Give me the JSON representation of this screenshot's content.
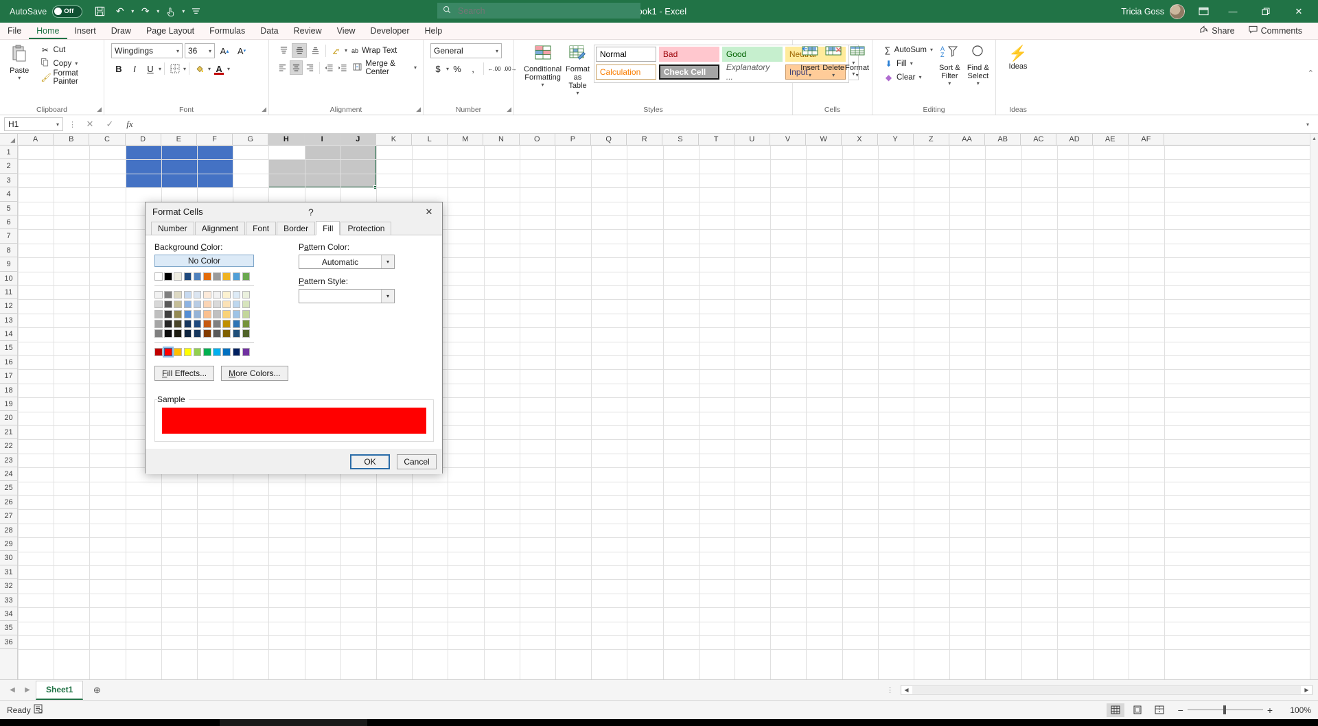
{
  "titlebar": {
    "autosave_label": "AutoSave",
    "autosave_state": "Off",
    "save_icon": "save-icon",
    "undo_icon": "undo-icon",
    "redo_icon": "redo-icon",
    "touch_icon": "touch-mode-icon",
    "customize_icon": "customize-quick-access-icon",
    "app_title": "Book1  -  Excel",
    "search_placeholder": "Search",
    "search_icon": "search-icon",
    "user_name": "Tricia Goss",
    "ribbon_display_icon": "ribbon-display-options-icon",
    "minimize_icon": "minimize-icon",
    "restore_icon": "restore-icon",
    "close_icon": "close-icon"
  },
  "tabs": [
    {
      "label": "File",
      "active": false
    },
    {
      "label": "Home",
      "active": true
    },
    {
      "label": "Insert",
      "active": false
    },
    {
      "label": "Draw",
      "active": false
    },
    {
      "label": "Page Layout",
      "active": false
    },
    {
      "label": "Formulas",
      "active": false
    },
    {
      "label": "Data",
      "active": false
    },
    {
      "label": "Review",
      "active": false
    },
    {
      "label": "View",
      "active": false
    },
    {
      "label": "Developer",
      "active": false
    },
    {
      "label": "Help",
      "active": false
    }
  ],
  "tabbar_right": {
    "share_label": "Share",
    "share_icon": "share-icon",
    "comments_label": "Comments",
    "comments_icon": "comments-icon"
  },
  "ribbon": {
    "clipboard": {
      "title": "Clipboard",
      "paste_label": "Paste",
      "paste_icon": "paste-icon",
      "cut_label": "Cut",
      "cut_icon": "scissors-icon",
      "copy_label": "Copy",
      "copy_icon": "copy-icon",
      "format_painter_label": "Format Painter",
      "format_painter_icon": "format-painter-icon",
      "launcher_icon": "dialog-launcher-icon"
    },
    "font": {
      "title": "Font",
      "font_name": "Wingdings",
      "font_size": "36",
      "grow_font_icon": "grow-font-icon",
      "shrink_font_icon": "shrink-font-icon",
      "bold_label": "B",
      "italic_label": "I",
      "underline_label": "U",
      "borders_icon": "borders-icon",
      "fill_color_icon": "fill-color-icon",
      "font_color_icon": "font-color-icon",
      "launcher_icon": "dialog-launcher-icon"
    },
    "alignment": {
      "title": "Alignment",
      "top_align_icon": "align-top-icon",
      "middle_align_icon": "align-middle-icon",
      "bottom_align_icon": "align-bottom-icon",
      "orientation_icon": "orientation-icon",
      "align_left_icon": "align-left-icon",
      "align_center_icon": "align-center-icon",
      "align_right_icon": "align-right-icon",
      "decrease_indent_icon": "decrease-indent-icon",
      "increase_indent_icon": "increase-indent-icon",
      "wrap_text_label": "Wrap Text",
      "wrap_text_icon": "wrap-text-icon",
      "merge_center_label": "Merge & Center",
      "merge_center_icon": "merge-center-icon",
      "launcher_icon": "dialog-launcher-icon"
    },
    "number": {
      "title": "Number",
      "format": "General",
      "currency_icon": "currency-icon",
      "percent_icon": "percent-icon",
      "comma_icon": "comma-style-icon",
      "increase_decimal_icon": "increase-decimal-icon",
      "decrease_decimal_icon": "decrease-decimal-icon",
      "launcher_icon": "dialog-launcher-icon"
    },
    "styles": {
      "title": "Styles",
      "conditional_formatting_label": "Conditional Formatting",
      "conditional_formatting_icon": "conditional-formatting-icon",
      "format_as_table_label": "Format as Table",
      "format_as_table_icon": "format-as-table-icon",
      "cells": [
        {
          "label": "Normal",
          "bg": "#ffffff",
          "fg": "#000000",
          "border": "#b0b0b0"
        },
        {
          "label": "Bad",
          "bg": "#ffc7ce",
          "fg": "#9c0006",
          "border": "#ffc7ce"
        },
        {
          "label": "Good",
          "bg": "#c6efce",
          "fg": "#006100",
          "border": "#c6efce"
        },
        {
          "label": "Neutral",
          "bg": "#ffeb9c",
          "fg": "#9c6500",
          "border": "#ffeb9c"
        },
        {
          "label": "Calculation",
          "bg": "#ffffff",
          "fg": "#fa7d00",
          "border": "#d0a060"
        },
        {
          "label": "Check Cell",
          "bg": "#a5a5a5",
          "fg": "#ffffff",
          "border": "#1a1a1a"
        },
        {
          "label": "Explanatory ...",
          "bg": "#ffffff",
          "fg": "#5a5a5a",
          "border": "#ffffff"
        },
        {
          "label": "Input",
          "bg": "#ffcc99",
          "fg": "#3f3f76",
          "border": "#cc9966"
        }
      ],
      "scroll_up_icon": "scroll-up-icon",
      "scroll_down_icon": "scroll-down-icon",
      "more_icon": "more-styles-icon"
    },
    "cells": {
      "title": "Cells",
      "insert_label": "Insert",
      "insert_icon": "insert-cells-icon",
      "delete_label": "Delete",
      "delete_icon": "delete-cells-icon",
      "format_label": "Format",
      "format_icon": "format-cells-icon"
    },
    "editing": {
      "title": "Editing",
      "autosum_label": "AutoSum",
      "autosum_icon": "sigma-icon",
      "fill_label": "Fill",
      "fill_icon": "fill-down-icon",
      "clear_label": "Clear",
      "clear_icon": "eraser-icon",
      "sort_filter_label": "Sort & Filter",
      "sort_filter_icon": "sort-filter-icon",
      "find_select_label": "Find & Select",
      "find_select_icon": "magnifier-icon"
    },
    "ideas": {
      "title": "Ideas",
      "ideas_label": "Ideas",
      "ideas_icon": "ideas-lightning-icon"
    },
    "collapse_icon": "collapse-ribbon-icon"
  },
  "formulabar": {
    "namebox_value": "H1",
    "namebox_caret_icon": "chevron-down-icon",
    "cancel_icon": "cancel-icon",
    "enter_icon": "enter-icon",
    "function_icon": "insert-function-icon",
    "formula_value": "",
    "expand_icon": "expand-formula-bar-icon"
  },
  "grid": {
    "columns": [
      "A",
      "B",
      "C",
      "D",
      "E",
      "F",
      "G",
      "H",
      "I",
      "J",
      "K",
      "L",
      "M",
      "N",
      "O",
      "P",
      "Q",
      "R",
      "S",
      "T",
      "U",
      "V",
      "W",
      "X",
      "Y",
      "Z",
      "AA",
      "AB",
      "AC",
      "AD",
      "AE",
      "AF"
    ],
    "selected_columns": [
      "H",
      "I",
      "J"
    ],
    "rows": [
      "1",
      "2",
      "3",
      "4",
      "5",
      "6",
      "7",
      "8",
      "9",
      "10",
      "11",
      "12",
      "13",
      "14",
      "15",
      "16",
      "17",
      "18",
      "19",
      "20",
      "21",
      "22",
      "23",
      "24",
      "25",
      "26",
      "27",
      "28",
      "29",
      "30",
      "31",
      "32",
      "33",
      "34",
      "35",
      "36"
    ],
    "fill_range": "D1:F3",
    "fill_color": "#4472c4",
    "selection_range": "H1:J3",
    "active_cell": "H1",
    "selection_border_color": "#1e6b45"
  },
  "sheetbar": {
    "prev_icon": "previous-sheet-icon",
    "next_icon": "next-sheet-icon",
    "sheets": [
      {
        "label": "Sheet1",
        "active": true
      }
    ],
    "add_sheet_icon": "add-sheet-icon",
    "scroll_left_icon": "scroll-left-icon",
    "scroll_right_icon": "scroll-right-icon"
  },
  "statusbar": {
    "status_text": "Ready",
    "accessibility_icon": "accessibility-checker-icon",
    "normal_view_icon": "normal-view-icon",
    "page_layout_icon": "page-layout-view-icon",
    "page_break_icon": "page-break-preview-icon",
    "zoom_out_icon": "zoom-out-icon",
    "zoom_in_icon": "zoom-in-icon",
    "zoom_level": "100%"
  },
  "dialog": {
    "title": "Format Cells",
    "help_icon": "help-icon",
    "close_icon": "close-icon",
    "tabs": [
      {
        "label": "Number",
        "active": false
      },
      {
        "label": "Alignment",
        "active": false
      },
      {
        "label": "Font",
        "active": false
      },
      {
        "label": "Border",
        "active": false
      },
      {
        "label": "Fill",
        "active": true
      },
      {
        "label": "Protection",
        "active": false
      }
    ],
    "background_color_label": "Background Color:",
    "no_color_label": "No Color",
    "theme_colors_row1": [
      "#ffffff",
      "#000000",
      "#eeece1",
      "#1f497d",
      "#4f81bd",
      "#e36c0a",
      "#9b9b9b",
      "#f0b323",
      "#4f9fd8",
      "#6aa84f"
    ],
    "theme_variants": [
      [
        "#f2f2f2",
        "#7f7f7f",
        "#ddd9c3",
        "#c6d9f0",
        "#dbe5f1",
        "#fdeada",
        "#f2f2f2",
        "#fdf2d0",
        "#ddebf7",
        "#ebf1de"
      ],
      [
        "#d8d8d8",
        "#595959",
        "#c4bd97",
        "#8db3e2",
        "#b8cce4",
        "#fbd5b5",
        "#d9d9d9",
        "#fbe2b7",
        "#bdd7ee",
        "#d7e4bd"
      ],
      [
        "#bfbfbf",
        "#3f3f3f",
        "#938953",
        "#548dd4",
        "#95b3d7",
        "#fac08f",
        "#c0c0c0",
        "#f9d277",
        "#9dc3e6",
        "#c3d69b"
      ],
      [
        "#a5a5a5",
        "#262626",
        "#494429",
        "#17365d",
        "#1f497d",
        "#c55a11",
        "#808080",
        "#bf8f00",
        "#2e75b6",
        "#76933c"
      ],
      [
        "#7f7f7f",
        "#0c0c0c",
        "#1d1b10",
        "#0f243e",
        "#16365c",
        "#833c00",
        "#595959",
        "#7f6000",
        "#1f4e79",
        "#4f6228"
      ]
    ],
    "standard_colors": [
      "#c00000",
      "#ff0000",
      "#ffc000",
      "#ffff00",
      "#92d050",
      "#00b050",
      "#00b0f0",
      "#0070c0",
      "#002060",
      "#7030a0"
    ],
    "selected_standard_color": "#ff0000",
    "fill_effects_label": "Fill Effects...",
    "more_colors_label": "More Colors...",
    "pattern_color_label": "Pattern Color:",
    "pattern_color_value": "Automatic",
    "pattern_style_label": "Pattern Style:",
    "pattern_style_value": "",
    "sample_label": "Sample",
    "sample_color": "#ff0000",
    "ok_label": "OK",
    "cancel_label": "Cancel",
    "dropdown_icon": "chevron-down-icon"
  }
}
